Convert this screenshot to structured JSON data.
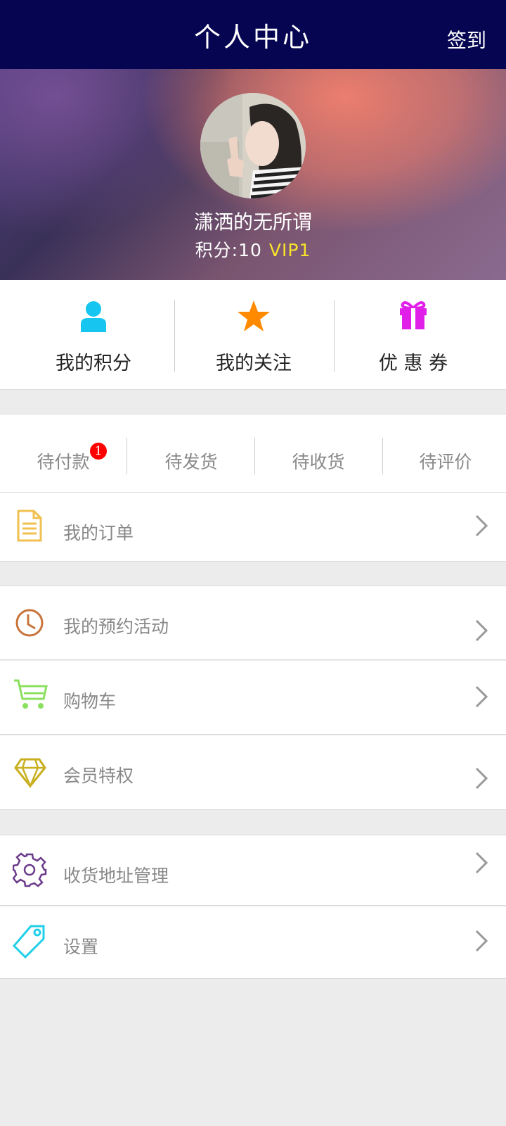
{
  "header": {
    "title": "个人中心",
    "signin_label": "签到"
  },
  "profile": {
    "username": "潇洒的无所谓",
    "points_label": "积分:10",
    "vip_label": "VIP1"
  },
  "quick_actions": [
    {
      "label": "我的积分",
      "icon": "user-icon",
      "color": "#16c6f0"
    },
    {
      "label": "我的关注",
      "icon": "star-icon",
      "color": "#ff8a00"
    },
    {
      "label": "优 惠 券",
      "icon": "gift-icon",
      "color": "#e020e8"
    }
  ],
  "order_tabs": [
    {
      "label": "待付款",
      "badge": "1"
    },
    {
      "label": "待发货"
    },
    {
      "label": "待收货"
    },
    {
      "label": "待评价"
    }
  ],
  "menu": {
    "my_orders": {
      "label": "我的订单",
      "icon": "document-icon",
      "color": "#f0c050"
    },
    "reservations": {
      "label": "我的预约活动",
      "icon": "clock-icon",
      "color": "#c8743a"
    },
    "cart": {
      "label": "购物车",
      "icon": "cart-icon",
      "color": "#8be060"
    },
    "membership": {
      "label": "会员特权",
      "icon": "diamond-icon",
      "color": "#c8b020"
    },
    "address": {
      "label": "收货地址管理",
      "icon": "gear-icon",
      "color": "#6a3a8a"
    },
    "settings": {
      "label": "设置",
      "icon": "tag-icon",
      "color": "#20d0e8"
    }
  },
  "colors": {
    "header_bg": "#050552",
    "vip": "#f7e32a",
    "badge": "#ff0000"
  }
}
